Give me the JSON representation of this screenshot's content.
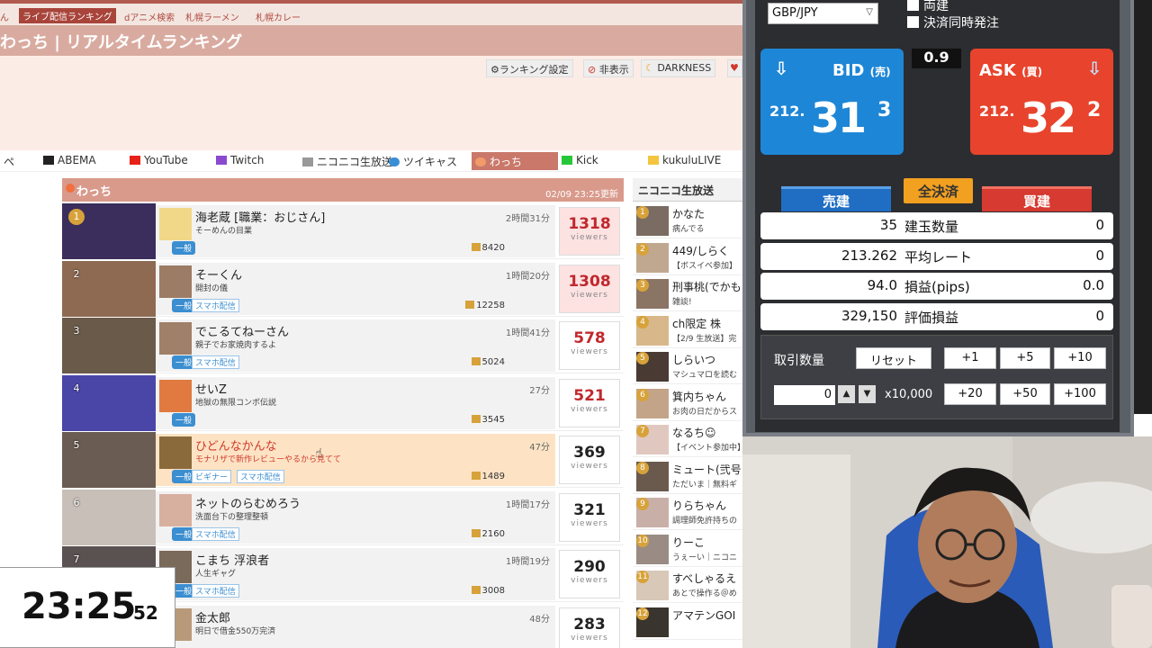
{
  "topnav": {
    "items": [
      "ん",
      "ライブ配信ランキング",
      "dアニメ検索",
      "札幌ラーメン",
      "札幌カレー"
    ],
    "active_index": 1
  },
  "title": "わっち | リアルタイムランキング",
  "toolbar": {
    "settings_label": "ランキング設定",
    "hide_label": "非表示",
    "darkness_label": "DARKNESS"
  },
  "platforms": {
    "items": [
      "ペ",
      "ABEMA",
      "YouTube",
      "Twitch",
      "ニコニコ生放送",
      "ツイキャス",
      "わっち",
      "Kick",
      "kukuluLIVE"
    ],
    "active_index": 6
  },
  "panel": {
    "name": "わっち",
    "updated": "02/09 23:25更新"
  },
  "rankings": [
    {
      "rank": "1",
      "name": "海老蔵 [職業：おじさん]",
      "desc": "そーめんの目業",
      "time": "2時間31分",
      "fans": "8420",
      "viewers": "1318",
      "viewers_label": "viewers",
      "badges": [
        "一般"
      ]
    },
    {
      "rank": "2",
      "name": "そーくん",
      "desc": "開封の儀",
      "time": "1時間20分",
      "fans": "12258",
      "viewers": "1308",
      "viewers_label": "viewers",
      "badges": [
        "一般",
        "スマホ配信"
      ]
    },
    {
      "rank": "3",
      "name": "でこるてねーさん",
      "desc": "親子でお家焼肉するよ",
      "time": "1時間41分",
      "fans": "5024",
      "viewers": "578",
      "viewers_label": "viewers",
      "badges": [
        "一般",
        "スマホ配信"
      ]
    },
    {
      "rank": "4",
      "name": "せいZ",
      "desc": "地獄の無限コンボ伝説",
      "time": "27分",
      "fans": "3545",
      "viewers": "521",
      "viewers_label": "viewers",
      "badges": [
        "一般"
      ]
    },
    {
      "rank": "5",
      "name": "ひどんなかんな",
      "desc": "モナリザで新作レビューやるから見てて",
      "time": "47分",
      "fans": "1489",
      "viewers": "369",
      "viewers_label": "viewers",
      "badges": [
        "一般",
        "ビギナー",
        "スマホ配信"
      ]
    },
    {
      "rank": "6",
      "name": "ネットのらむめろう",
      "desc": "洗面台下の整理整頓",
      "time": "1時間17分",
      "fans": "2160",
      "viewers": "321",
      "viewers_label": "viewers",
      "badges": [
        "一般",
        "スマホ配信"
      ]
    },
    {
      "rank": "7",
      "name": "こまち 浮浪者",
      "desc": "人生ギャグ",
      "time": "1時間19分",
      "fans": "3008",
      "viewers": "290",
      "viewers_label": "viewers",
      "badges": [
        "一般",
        "スマホ配信"
      ]
    },
    {
      "rank": "8",
      "name": "金太郎",
      "desc": "明日で借金550万完済",
      "time": "48分",
      "fans": "",
      "viewers": "283",
      "viewers_label": "viewers",
      "badges": []
    }
  ],
  "nico": {
    "header": "ニコニコ生放送",
    "items": [
      {
        "rank": "1",
        "name": "かなた",
        "desc": "病んでる"
      },
      {
        "rank": "2",
        "name": "449/しらく",
        "desc": "【ボスイベ参加】"
      },
      {
        "rank": "3",
        "name": "刑事桃(でかも",
        "desc": "雑談!"
      },
      {
        "rank": "4",
        "name": "ch限定 株",
        "desc": "【2/9 生放送】完"
      },
      {
        "rank": "5",
        "name": "しらいつ",
        "desc": "マシュマロを読む"
      },
      {
        "rank": "6",
        "name": "箕内ちゃん",
        "desc": "お肉の日だからス"
      },
      {
        "rank": "7",
        "name": "なるち☺",
        "desc": "【イベント参加中】"
      },
      {
        "rank": "8",
        "name": "ミュート(弐号",
        "desc": "ただいま｜無料ギ"
      },
      {
        "rank": "9",
        "name": "りらちゃん",
        "desc": "調理師免許持ちの"
      },
      {
        "rank": "10",
        "name": "りーこ",
        "desc": "うぇーい｜ニコニ"
      },
      {
        "rank": "11",
        "name": "すべしゃるえ",
        "desc": "あとで操作る＠め"
      },
      {
        "rank": "12",
        "name": "アマテンGOI",
        "desc": ""
      }
    ]
  },
  "clock": {
    "hm": "23:25",
    "sec": "52"
  },
  "trade": {
    "pair": "GBP/JPY",
    "check1": "両建",
    "check2": "決済同時発注",
    "spread": "0.9",
    "bid_label": "BID",
    "bid_sub": "(売)",
    "bid_prefix": "212.",
    "bid_big": "31",
    "bid_sup": "3",
    "ask_label": "ASK",
    "ask_sub": "(買)",
    "ask_prefix": "212.",
    "ask_big": "32",
    "ask_sup": "2",
    "sell_tab": "売建",
    "close_all": "全決済",
    "buy_tab": "買建",
    "rows": [
      {
        "left": "35",
        "label": "建玉数量",
        "right": "0"
      },
      {
        "left": "213.262",
        "label": "平均レート",
        "right": "0"
      },
      {
        "left": "94.0",
        "label": "損益(pips)",
        "right": "0.0"
      },
      {
        "left": "329,150",
        "label": "評価損益",
        "right": "0"
      }
    ],
    "order_label": "取引数量",
    "reset": "リセット",
    "qty": "0",
    "unit": "x10,000",
    "buttons": [
      "+1",
      "+5",
      "+10",
      "+20",
      "+50",
      "+100"
    ]
  },
  "colors": {
    "bid": "#1e86d6",
    "ask": "#e8432c",
    "accent": "#a8443a"
  }
}
